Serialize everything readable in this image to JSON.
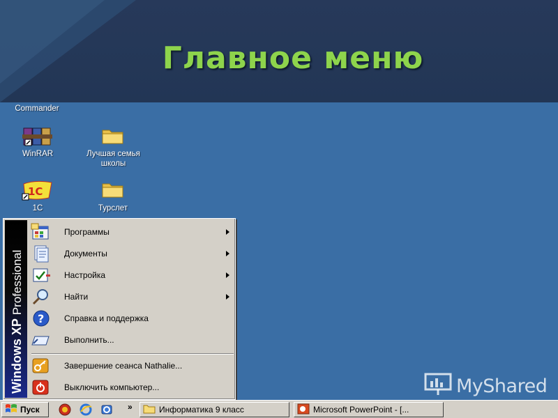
{
  "slide": {
    "title": "Главное меню"
  },
  "desktop": {
    "icons": [
      {
        "label": "Commander",
        "icon": "total-commander-icon"
      },
      {
        "label": "WinRAR",
        "icon": "winrar-icon"
      },
      {
        "label": "Лучшая семья школы",
        "icon": "folder-icon"
      },
      {
        "label": "1С",
        "icon": "1c-icon"
      },
      {
        "label": "Турслет",
        "icon": "folder-icon"
      }
    ]
  },
  "start_menu": {
    "side_brand": "Windows XP",
    "side_edition": "Professional",
    "items": [
      {
        "label": "Программы",
        "icon": "programs-icon",
        "submenu": true
      },
      {
        "label": "Документы",
        "icon": "documents-icon",
        "submenu": true
      },
      {
        "label": "Настройка",
        "icon": "settings-icon",
        "submenu": true
      },
      {
        "label": "Найти",
        "icon": "search-icon",
        "submenu": true
      },
      {
        "label": "Справка и поддержка",
        "icon": "help-icon",
        "submenu": false
      },
      {
        "label": "Выполнить...",
        "icon": "run-icon",
        "submenu": false
      },
      {
        "label": "Завершение сеанса Nathalie...",
        "icon": "logoff-icon",
        "submenu": false
      },
      {
        "label": "Выключить компьютер...",
        "icon": "shutdown-icon",
        "submenu": false
      }
    ]
  },
  "taskbar": {
    "start_label": "Пуск",
    "quick_launch": [
      "browser-icon",
      "ie-icon",
      "outlook-icon"
    ],
    "chevron": "»",
    "tasks": [
      {
        "label": "Информатика 9 класс",
        "icon": "folder-icon"
      },
      {
        "label": "Microsoft PowerPoint - [...",
        "icon": "powerpoint-icon"
      }
    ]
  },
  "watermark": {
    "text": "MyShared"
  },
  "colors": {
    "desktop": "#3a6ea5",
    "title_band": "#27395a",
    "title_text": "#8ed44c",
    "menu_bg": "#d4d0c8"
  }
}
